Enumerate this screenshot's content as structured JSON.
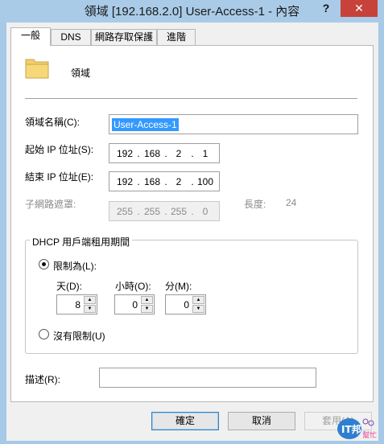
{
  "window": {
    "title": "領域 [192.168.2.0] User-Access-1 - 內容",
    "help_label": "?",
    "close_label": "✕"
  },
  "tabs": [
    "一般",
    "DNS",
    "網路存取保護",
    "進階"
  ],
  "header": {
    "icon": "folder-icon",
    "label": "領域"
  },
  "scope_name": {
    "label": "領域名稱(C):",
    "value": "User-Access-1"
  },
  "start_ip": {
    "label": "起始 IP 位址(S):",
    "octets": [
      "192",
      "168",
      "2",
      "1"
    ]
  },
  "end_ip": {
    "label": "結束 IP 位址(E):",
    "octets": [
      "192",
      "168",
      "2",
      "100"
    ]
  },
  "subnet": {
    "label": "子網路遮罩:",
    "octets": [
      "255",
      "255",
      "255",
      "0"
    ],
    "length_label": "長度:",
    "length_value": "24"
  },
  "lease": {
    "group_title": "DHCP 用戶端租用期間",
    "limited_label": "限制為(L):",
    "days_label": "天(D):",
    "days_value": "8",
    "hours_label": "小時(O):",
    "hours_value": "0",
    "minutes_label": "分(M):",
    "minutes_value": "0",
    "unlimited_label": "沒有限制(U)"
  },
  "description": {
    "label": "描述(R):",
    "value": ""
  },
  "buttons": {
    "ok": "確定",
    "cancel": "取消",
    "apply": "套用(A)"
  },
  "watermark": {
    "brand_text": "IT邦",
    "sub_text": "幫忙"
  },
  "colors": {
    "selection": "#3399ff",
    "close": "#c7423a",
    "frame": "#a6c9e7"
  }
}
